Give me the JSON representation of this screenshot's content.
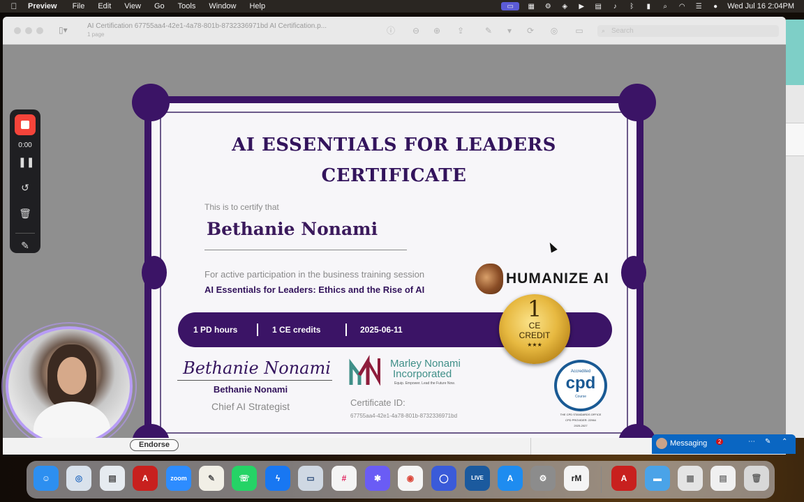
{
  "menubar": {
    "app_name": "Preview",
    "items": [
      "File",
      "Edit",
      "View",
      "Go",
      "Tools",
      "Window",
      "Help"
    ],
    "clock": "Wed Jul 16  2:04PM"
  },
  "window": {
    "doc_title": "AI Certification 67755aa4-42e1-4a78-801b-8732336971bd AI Certification.p...",
    "doc_subtitle": "1 page",
    "search_placeholder": "Search"
  },
  "certificate": {
    "title_line1": "AI ESSENTIALS FOR LEADERS",
    "title_line2": "CERTIFICATE",
    "certify_text": "This is to certify that",
    "recipient": "Bethanie Nonami",
    "participation_text": "For active participation in the business training session",
    "session_title": "AI Essentials for Leaders: Ethics and the Rise of AI",
    "humanize_brand": "HUMANIZE AI",
    "pd_hours": "1 PD hours",
    "ce_credits": "1 CE credits",
    "date": "2025-06-11",
    "seal": {
      "number": "1",
      "line1": "CE",
      "line2": "CREDIT",
      "stars": "★★★"
    },
    "signature": "Bethanie Nonami",
    "signer_name": "Bethanie Nonami",
    "signer_title": "Chief AI Strategist",
    "org_line1": "Marley Nonami",
    "org_line2": "Incorporated",
    "org_tagline": "Equip. Empower. Lead the Future Now.",
    "cert_id_label": "Certificate ID:",
    "cert_id": "67755aa4-42e1-4a78-801b-8732336971bd",
    "cpd": {
      "accredited": "Accredited",
      "big": "cpd",
      "course": "Course",
      "footer": "THE CPD STANDARDS OFFICE",
      "provider": "CPD PROVIDER: 22964",
      "years": "2025-2027"
    }
  },
  "recorder": {
    "time": "0:00"
  },
  "linkedin": {
    "endorse_label": "Endorse",
    "messaging_label": "Messaging",
    "messaging_badge": "2"
  },
  "dock": {
    "zoom_label": "zoom",
    "live_label": "LIVE",
    "rm_label": "rM"
  },
  "colors": {
    "cert_purple": "#3b1466",
    "seal_gold": "#e7b941",
    "cpd_blue": "#1a5a94",
    "teal": "#3f8f88",
    "linkedin_blue": "#0a66c2",
    "record_red": "#f5443a"
  }
}
